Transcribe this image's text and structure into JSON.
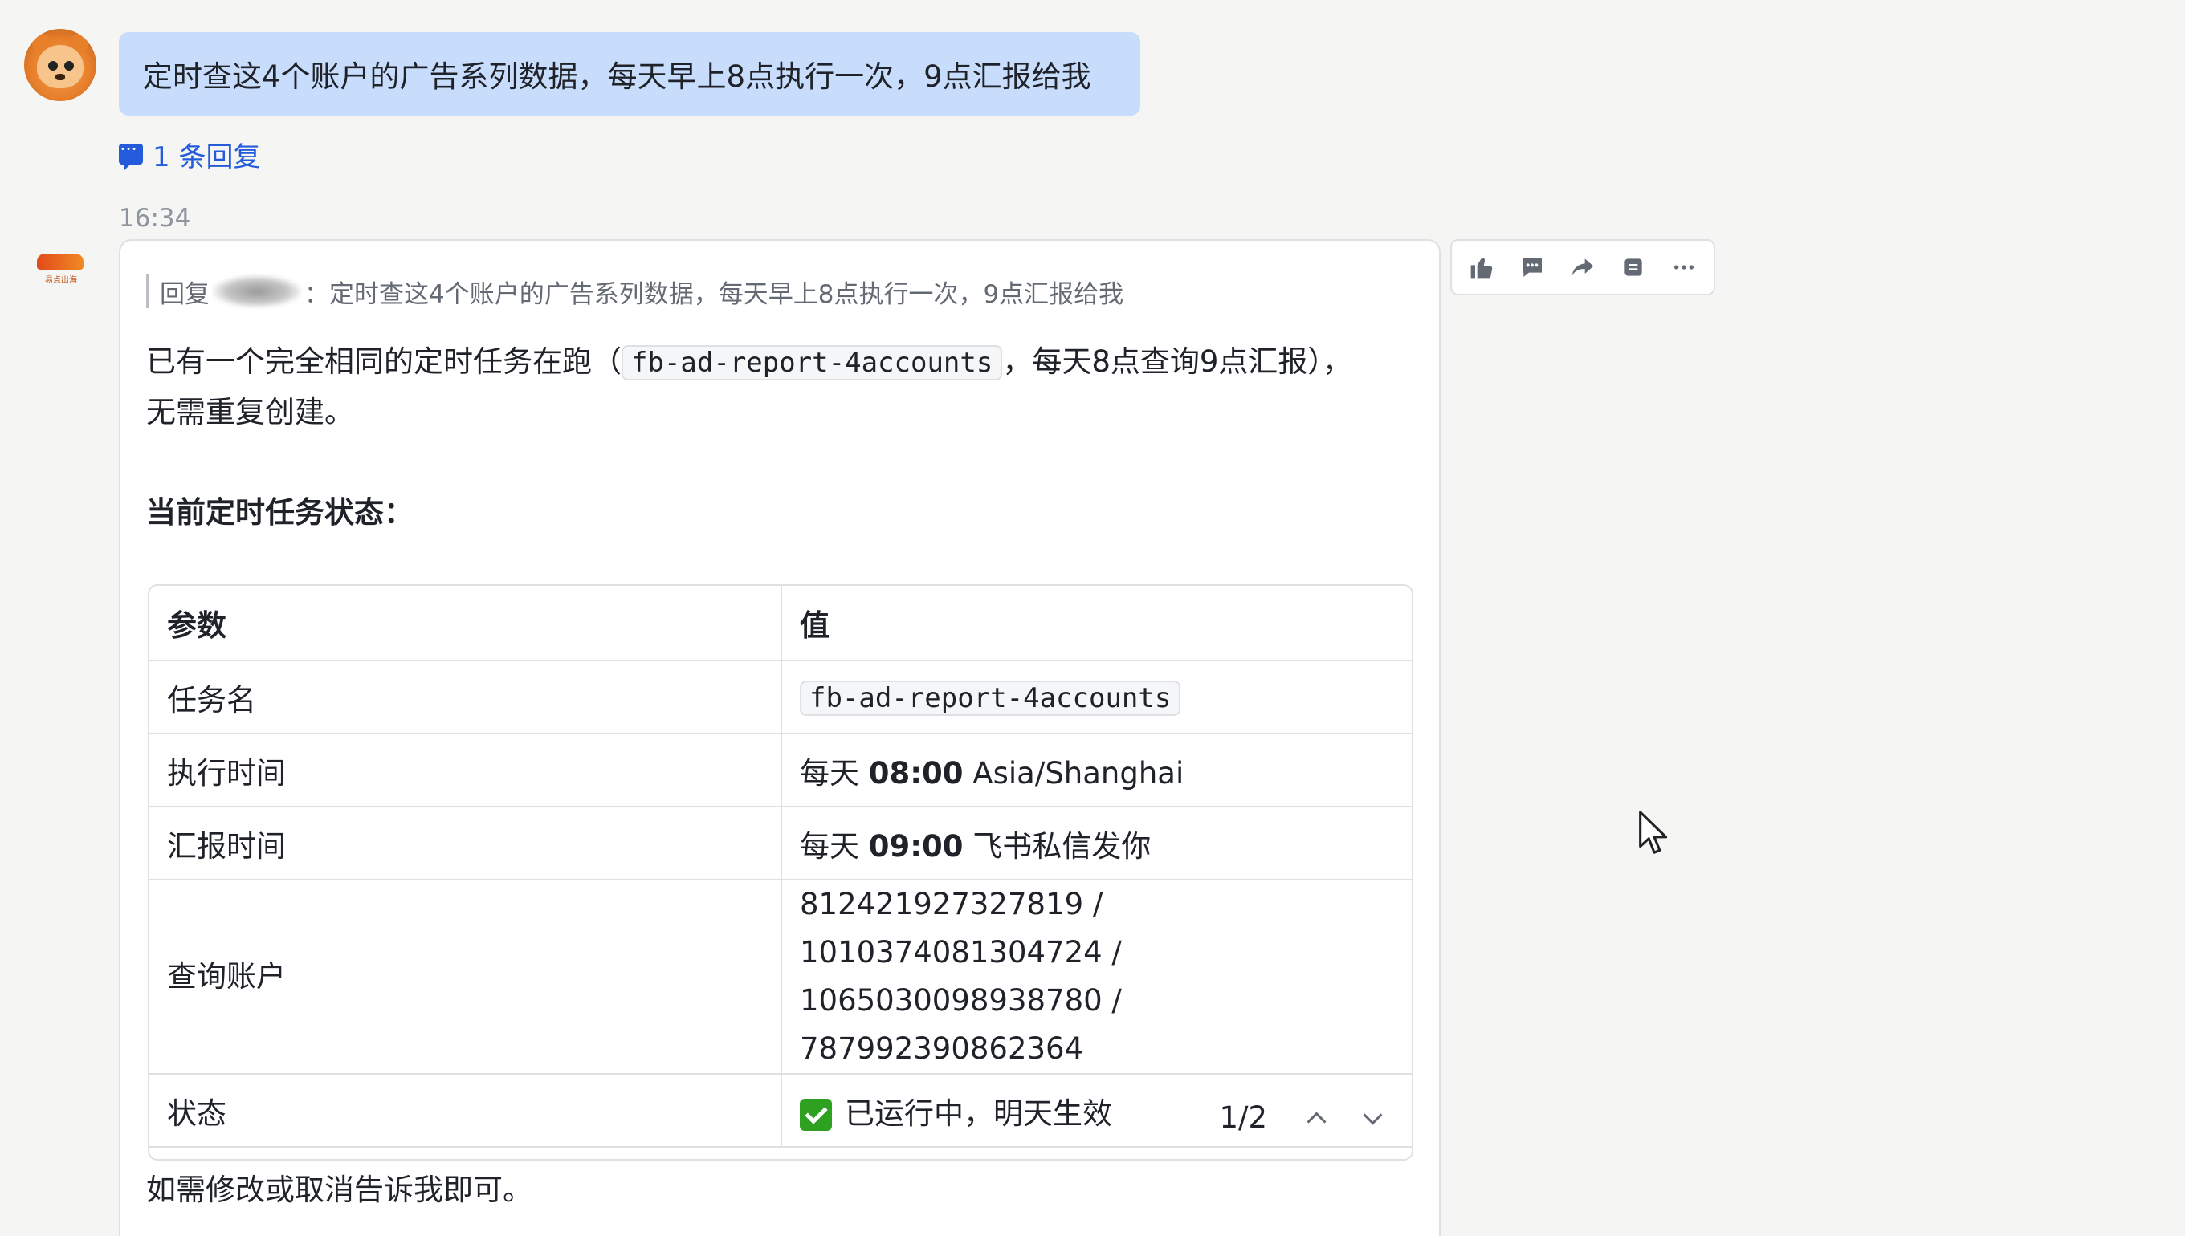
{
  "user_message": {
    "text": "定时查这4个账户的广告系列数据，每天早上8点执行一次，9点汇报给我",
    "reply_link": "1 条回复"
  },
  "bot_message": {
    "timestamp": "16:34",
    "quote_prefix": "回复",
    "quote_text": "：定时查这4个账户的广告系列数据，每天早上8点执行一次，9点汇报给我",
    "intro_before": "已有一个完全相同的定时任务在跑（",
    "intro_code": "fb-ad-report-4accounts",
    "intro_after": "，每天8点查询9点汇报），无需重复创建。",
    "section_title": "当前定时任务状态：",
    "table": {
      "header_param": "参数",
      "header_value": "值",
      "rows": [
        {
          "param": "任务名",
          "value": "fb-ad-report-4accounts"
        },
        {
          "param": "执行时间",
          "value_prefix": "每天 ",
          "value_bold": "08:00",
          "value_suffix": " Asia/Shanghai"
        },
        {
          "param": "汇报时间",
          "value_prefix": "每天 ",
          "value_bold": "09:00",
          "value_suffix": " 飞书私信发你"
        },
        {
          "param": "查询账户",
          "value_line1": "812421927327819 / 1010374081304724 /",
          "value_line2": "1065030098938780 / 787992390862364"
        },
        {
          "param": "状态",
          "value": "已运行中，明天生效"
        }
      ],
      "pager": "1/2"
    },
    "footer": "如需修改或取消告诉我即可。",
    "bot_logo_text": "易点出海"
  },
  "toolbar": {
    "icons": [
      "thumbs-up-icon",
      "comment-icon",
      "forward-icon",
      "pin-icon",
      "more-icon"
    ]
  },
  "colors": {
    "user_bubble": "#c8dcfb",
    "link": "#245bdb",
    "status_check": "#2ea121"
  }
}
